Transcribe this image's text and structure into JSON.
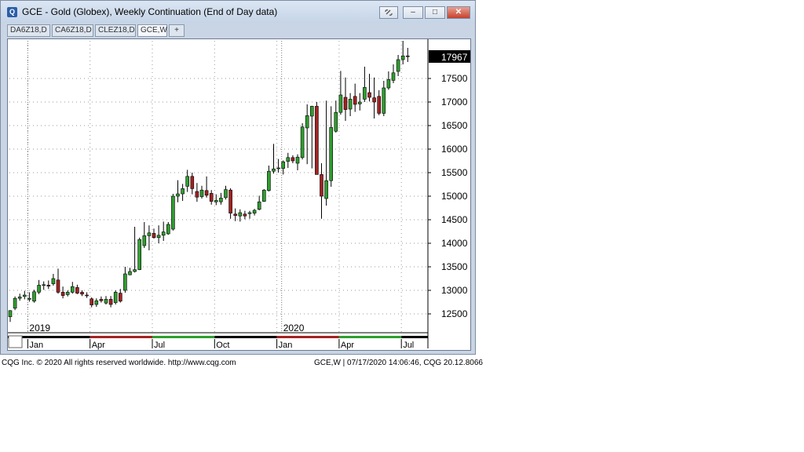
{
  "window": {
    "title": "GCE - Gold (Globex), Weekly Continuation (End of Day data)",
    "app_icon": "Q",
    "buttons": {
      "link": "link-icon",
      "minimize": "–",
      "maximize": "□",
      "close": "✕"
    }
  },
  "tabs": [
    {
      "label": "DA6Z18,D",
      "active": false
    },
    {
      "label": "CA6Z18,D",
      "active": false
    },
    {
      "label": "CLEZ18,D",
      "active": false
    },
    {
      "label": "GCE,W",
      "active": true
    },
    {
      "label": "+",
      "active": false
    }
  ],
  "footer": {
    "left": "CQG Inc. © 2020 All rights reserved worldwide. http://www.cqg.com",
    "right": "GCE,W | 07/17/2020 14:06:46, CQG 20.12.8066"
  },
  "colors": {
    "up": "#2f9e2f",
    "down": "#a32222",
    "accent": "#2a5fa8"
  },
  "chart_data": {
    "type": "candlestick",
    "ylim": [
      12100,
      18300
    ],
    "y_ticks": [
      12500,
      13000,
      13500,
      14000,
      14500,
      15000,
      15500,
      16000,
      16500,
      17000,
      17500
    ],
    "last_price": "17967",
    "year_labels": [
      "2019",
      "2020"
    ],
    "month_labels": [
      "Jan",
      "Apr",
      "Jul",
      "Oct",
      "Jan",
      "Apr",
      "Jul"
    ],
    "grid": true,
    "candles": [
      {
        "o": 12440,
        "h": 12580,
        "l": 12330,
        "c": 12570
      },
      {
        "o": 12620,
        "h": 12870,
        "l": 12580,
        "c": 12830
      },
      {
        "o": 12830,
        "h": 12930,
        "l": 12780,
        "c": 12860
      },
      {
        "o": 12870,
        "h": 12990,
        "l": 12810,
        "c": 12900
      },
      {
        "o": 12810,
        "h": 12960,
        "l": 12760,
        "c": 12830
      },
      {
        "o": 12770,
        "h": 13010,
        "l": 12740,
        "c": 12970
      },
      {
        "o": 12960,
        "h": 13220,
        "l": 12920,
        "c": 13110
      },
      {
        "o": 13110,
        "h": 13190,
        "l": 13010,
        "c": 13120
      },
      {
        "o": 13110,
        "h": 13210,
        "l": 13030,
        "c": 13090
      },
      {
        "o": 13140,
        "h": 13350,
        "l": 13100,
        "c": 13250
      },
      {
        "o": 13220,
        "h": 13460,
        "l": 12930,
        "c": 12960
      },
      {
        "o": 12960,
        "h": 13080,
        "l": 12830,
        "c": 12890
      },
      {
        "o": 12910,
        "h": 13000,
        "l": 12870,
        "c": 12960
      },
      {
        "o": 12960,
        "h": 13180,
        "l": 12930,
        "c": 13080
      },
      {
        "o": 13060,
        "h": 13120,
        "l": 12920,
        "c": 12940
      },
      {
        "o": 12960,
        "h": 13000,
        "l": 12880,
        "c": 12920
      },
      {
        "o": 12900,
        "h": 12960,
        "l": 12840,
        "c": 12890
      },
      {
        "o": 12820,
        "h": 12850,
        "l": 12640,
        "c": 12690
      },
      {
        "o": 12700,
        "h": 12830,
        "l": 12650,
        "c": 12780
      },
      {
        "o": 12810,
        "h": 12870,
        "l": 12740,
        "c": 12780
      },
      {
        "o": 12730,
        "h": 12880,
        "l": 12700,
        "c": 12810
      },
      {
        "o": 12810,
        "h": 12880,
        "l": 12640,
        "c": 12700
      },
      {
        "o": 12740,
        "h": 13000,
        "l": 12700,
        "c": 12960
      },
      {
        "o": 12940,
        "h": 13030,
        "l": 12740,
        "c": 12770
      },
      {
        "o": 13000,
        "h": 13500,
        "l": 12950,
        "c": 13350
      },
      {
        "o": 13330,
        "h": 13480,
        "l": 13320,
        "c": 13400
      },
      {
        "o": 13400,
        "h": 14350,
        "l": 13380,
        "c": 13440
      },
      {
        "o": 13440,
        "h": 14120,
        "l": 13430,
        "c": 14080
      },
      {
        "o": 13950,
        "h": 14450,
        "l": 13900,
        "c": 14160
      },
      {
        "o": 14160,
        "h": 14380,
        "l": 13850,
        "c": 14220
      },
      {
        "o": 14210,
        "h": 14310,
        "l": 14100,
        "c": 14120
      },
      {
        "o": 14120,
        "h": 14380,
        "l": 14000,
        "c": 14170
      },
      {
        "o": 14170,
        "h": 14460,
        "l": 14050,
        "c": 14240
      },
      {
        "o": 14200,
        "h": 14450,
        "l": 14180,
        "c": 14400
      },
      {
        "o": 14300,
        "h": 15050,
        "l": 14270,
        "c": 15000
      },
      {
        "o": 15000,
        "h": 15340,
        "l": 14870,
        "c": 15050
      },
      {
        "o": 15050,
        "h": 15260,
        "l": 14900,
        "c": 15160
      },
      {
        "o": 15210,
        "h": 15560,
        "l": 15090,
        "c": 15420
      },
      {
        "o": 15420,
        "h": 15500,
        "l": 15040,
        "c": 15160
      },
      {
        "o": 15100,
        "h": 15280,
        "l": 14880,
        "c": 14980
      },
      {
        "o": 14990,
        "h": 15220,
        "l": 14950,
        "c": 15130
      },
      {
        "o": 15120,
        "h": 15420,
        "l": 14970,
        "c": 15020
      },
      {
        "o": 15060,
        "h": 15130,
        "l": 14820,
        "c": 14890
      },
      {
        "o": 14880,
        "h": 15040,
        "l": 14810,
        "c": 14910
      },
      {
        "o": 14880,
        "h": 15070,
        "l": 14820,
        "c": 14960
      },
      {
        "o": 14970,
        "h": 15220,
        "l": 14930,
        "c": 15140
      },
      {
        "o": 15130,
        "h": 15170,
        "l": 14520,
        "c": 14640
      },
      {
        "o": 14620,
        "h": 14740,
        "l": 14470,
        "c": 14590
      },
      {
        "o": 14580,
        "h": 14720,
        "l": 14460,
        "c": 14650
      },
      {
        "o": 14620,
        "h": 14690,
        "l": 14510,
        "c": 14580
      },
      {
        "o": 14630,
        "h": 14690,
        "l": 14520,
        "c": 14650
      },
      {
        "o": 14640,
        "h": 14730,
        "l": 14590,
        "c": 14700
      },
      {
        "o": 14720,
        "h": 15010,
        "l": 14700,
        "c": 14880
      },
      {
        "o": 14890,
        "h": 15150,
        "l": 14880,
        "c": 15130
      },
      {
        "o": 15120,
        "h": 15650,
        "l": 15100,
        "c": 15530
      },
      {
        "o": 15530,
        "h": 16110,
        "l": 15480,
        "c": 15580
      },
      {
        "o": 15590,
        "h": 15790,
        "l": 15500,
        "c": 15600
      },
      {
        "o": 15590,
        "h": 15760,
        "l": 15460,
        "c": 15730
      },
      {
        "o": 15740,
        "h": 15920,
        "l": 15600,
        "c": 15820
      },
      {
        "o": 15820,
        "h": 15870,
        "l": 15700,
        "c": 15750
      },
      {
        "o": 15700,
        "h": 15890,
        "l": 15550,
        "c": 15830
      },
      {
        "o": 15820,
        "h": 16550,
        "l": 15780,
        "c": 16470
      },
      {
        "o": 16450,
        "h": 16950,
        "l": 15680,
        "c": 16710
      },
      {
        "o": 16700,
        "h": 16920,
        "l": 15590,
        "c": 16910
      },
      {
        "o": 16910,
        "h": 17000,
        "l": 15620,
        "c": 15460
      },
      {
        "o": 15460,
        "h": 15700,
        "l": 14520,
        "c": 15000
      },
      {
        "o": 14950,
        "h": 17030,
        "l": 14800,
        "c": 15330
      },
      {
        "o": 15330,
        "h": 16910,
        "l": 15200,
        "c": 16460
      },
      {
        "o": 16380,
        "h": 17030,
        "l": 16350,
        "c": 16780
      },
      {
        "o": 16780,
        "h": 17660,
        "l": 16730,
        "c": 17150
      },
      {
        "o": 17100,
        "h": 17520,
        "l": 16600,
        "c": 16840
      },
      {
        "o": 16850,
        "h": 17190,
        "l": 16700,
        "c": 17060
      },
      {
        "o": 17120,
        "h": 17390,
        "l": 16790,
        "c": 16950
      },
      {
        "o": 16960,
        "h": 17190,
        "l": 16820,
        "c": 17000
      },
      {
        "o": 17060,
        "h": 17750,
        "l": 17000,
        "c": 17310
      },
      {
        "o": 17200,
        "h": 17600,
        "l": 17010,
        "c": 17100
      },
      {
        "o": 17090,
        "h": 17520,
        "l": 16650,
        "c": 17000
      },
      {
        "o": 17120,
        "h": 17250,
        "l": 16720,
        "c": 16760
      },
      {
        "o": 16760,
        "h": 17450,
        "l": 16700,
        "c": 17300
      },
      {
        "o": 17300,
        "h": 17650,
        "l": 17260,
        "c": 17480
      },
      {
        "o": 17460,
        "h": 17800,
        "l": 17400,
        "c": 17620
      },
      {
        "o": 17650,
        "h": 18000,
        "l": 17550,
        "c": 17900
      },
      {
        "o": 17900,
        "h": 18300,
        "l": 17800,
        "c": 17980
      },
      {
        "o": 17980,
        "h": 18150,
        "l": 17850,
        "c": 17967
      }
    ]
  }
}
